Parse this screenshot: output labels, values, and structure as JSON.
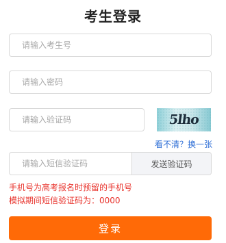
{
  "page": {
    "title": "考生登录"
  },
  "form": {
    "name_placeholder": "请输入考生号",
    "password_placeholder": "请输入密码",
    "captcha_placeholder": "请输入验证码",
    "sms_placeholder": "请输入短信验证码"
  },
  "captcha": {
    "text": "5lho",
    "refresh_label": "看不清？换一张"
  },
  "sms": {
    "send_label": "发送验证码"
  },
  "notes": [
    "手机号为高考报名时预留的手机号",
    "模拟期间短信验证码为：0000"
  ],
  "login": {
    "label": "登录"
  },
  "colors": {
    "accent": "#ff6a07",
    "link": "#2f6fd6",
    "warning": "#e8322b"
  }
}
